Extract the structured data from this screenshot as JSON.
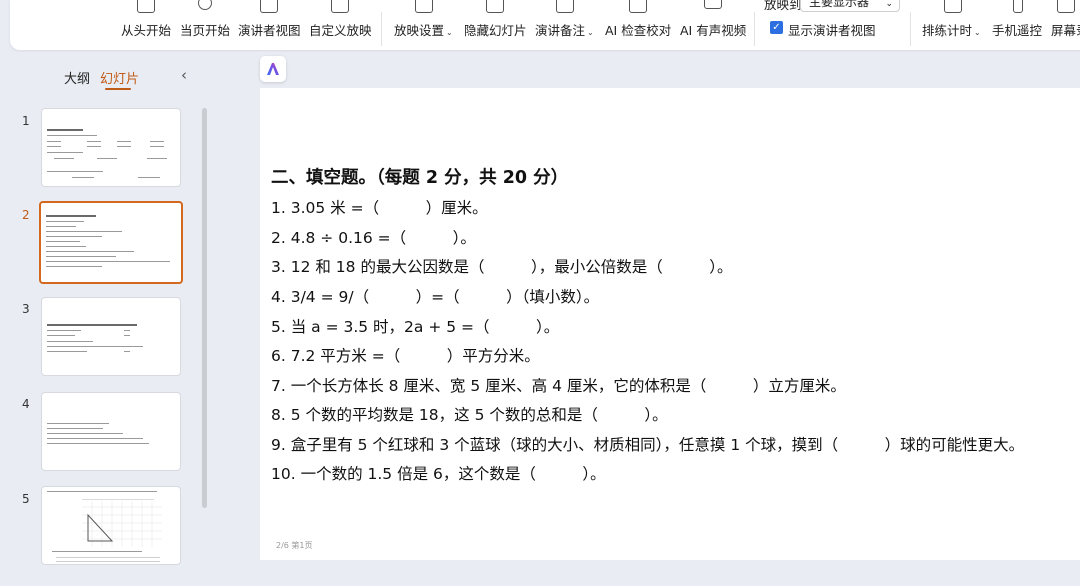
{
  "ribbon": {
    "buttons": [
      {
        "label": "从头开始",
        "caret": false,
        "icon": "play-from-start-icon"
      },
      {
        "label": "当页开始",
        "caret": false,
        "icon": "play-current-icon"
      },
      {
        "label": "演讲者视图",
        "caret": false,
        "icon": "presenter-view-icon"
      },
      {
        "label": "自定义放映",
        "caret": false,
        "icon": "custom-show-icon"
      },
      {
        "label": "放映设置",
        "caret": true,
        "icon": "slideshow-settings-icon"
      },
      {
        "label": "隐藏幻灯片",
        "caret": false,
        "icon": "hide-slide-icon"
      },
      {
        "label": "演讲备注",
        "caret": true,
        "icon": "speaker-notes-icon"
      },
      {
        "label": "AI 检查校对",
        "caret": false,
        "icon": "ai-proofread-icon"
      },
      {
        "label": "AI 有声视频",
        "caret": false,
        "icon": "ai-video-icon"
      },
      {
        "label": "排练计时",
        "caret": true,
        "icon": "rehearse-timing-icon"
      },
      {
        "label": "手机遥控",
        "caret": false,
        "icon": "phone-remote-icon"
      },
      {
        "label": "屏幕录",
        "caret": false,
        "icon": "screen-record-icon"
      }
    ],
    "show_on_label": "放映到",
    "monitor_select": "主要显示器",
    "presenter_checkbox_label": "显示演讲者视图",
    "presenter_checkbox_checked": true
  },
  "left_panel": {
    "tab_outline": "大纲",
    "tab_slides": "幻灯片",
    "active_tab": "幻灯片",
    "collapse_icon": "chevron-left-icon",
    "slide_numbers": [
      "1",
      "2",
      "3",
      "4",
      "5"
    ],
    "active_slide": "2"
  },
  "slide": {
    "heading": "二、填空题。（每题 2 分，共 20 分）",
    "questions": [
      "1. 3.05 米 =（　　　）厘米。",
      "2. 4.8 ÷ 0.16 =（　　　）。",
      "3. 12 和 18 的最大公因数是（　　　），最小公倍数是（　　　）。",
      "4. 3/4 = 9/（　　　）=（　　　）（填小数）。",
      "5. 当 a = 3.5 时，2a + 5 =（　　　）。",
      "6. 7.2 平方米 =（　　　）平方分米。",
      "7. 一个长方体长 8 厘米、宽 5 厘米、高 4 厘米，它的体积是（　　　）立方厘米。",
      "8. 5 个数的平均数是 18，这 5 个数的总和是（　　　）。",
      "9. 盒子里有 5 个红球和 3 个蓝球（球的大小、材质相同），任意摸 1 个球，摸到（　　　）球的可能性更大。",
      "10. 一个数的 1.5 倍是 6，这个数是（　　　）。"
    ],
    "footer": "2/6 第1页"
  },
  "colors": {
    "accent": "#c05a17",
    "checkbox": "#2b6fe0",
    "background": "#e9edf3"
  }
}
